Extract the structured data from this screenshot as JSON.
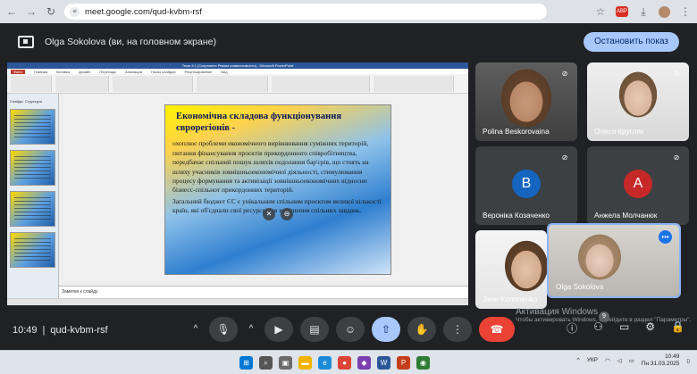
{
  "browser": {
    "url": "meet.google.com/qud-kvbm-rsf"
  },
  "presenting": {
    "text": "Olga Sokolova (ви, на головном экране)",
    "stop_label": "Остановить показ"
  },
  "powerpoint": {
    "title_bar": "Тема 3.1 (Сохранено Режим совместимости) - Microsoft PowerPoint",
    "tabs": [
      "Файл",
      "Главная",
      "Вставка",
      "Дизайн",
      "Переходы",
      "Анимация",
      "Показ слайдов",
      "Рецензирование",
      "Вид"
    ],
    "thumb_tabs": [
      "Слайды",
      "Структура"
    ],
    "notes_placeholder": "Заметки к слайду",
    "slide": {
      "title": "Економічна складова функціонування єврорегіонів -",
      "paragraph1": "охоплює проблеми економічного вирівнювання суміжних територій, питання фінансування проєктів прикордонного співробітництва, передбачає спільний пошук шляхів подолання бар'єрів, що стоять на шляху учасників зовнішньоекономічної діяльності, стимулювання процесу формування та активізації зовнішньоекономічних відносин бізнесс-спільнот прикордонних територій.",
      "paragraph2": "Загальний бюджет ЄС є унікальним спільним проєктом великої кількості країн, які об'єднали свої ресурси для вирішення спільних завдань."
    }
  },
  "participants": [
    {
      "name": "Polina Beskorovaina",
      "type": "video"
    },
    {
      "name": "Олеся Кругляк",
      "type": "video"
    },
    {
      "name": "Вероніка Козаченко",
      "type": "avatar",
      "initial": "В",
      "color": "#1565c0"
    },
    {
      "name": "Анжела Молчанюк",
      "type": "avatar",
      "initial": "А",
      "color": "#c62828"
    },
    {
      "name": "Jane Kononenko",
      "type": "video"
    },
    {
      "name": "Olga Sokolova",
      "type": "video",
      "speaking": true
    }
  ],
  "meeting": {
    "time": "10:49",
    "code": "qud-kvbm-rsf",
    "participants_count": "9"
  },
  "windows": {
    "activation_line1": "Активация Windows",
    "activation_line2": "Чтобы активировать Windows, перейдите в раздел \"Параметры\".",
    "lang": "УКР",
    "clock_time": "10:49",
    "clock_date": "Пн 31.03.2025"
  },
  "colors": {
    "leave_button": "#ea4335",
    "present_button": "#a8c7fa",
    "meet_bg": "#202124"
  }
}
